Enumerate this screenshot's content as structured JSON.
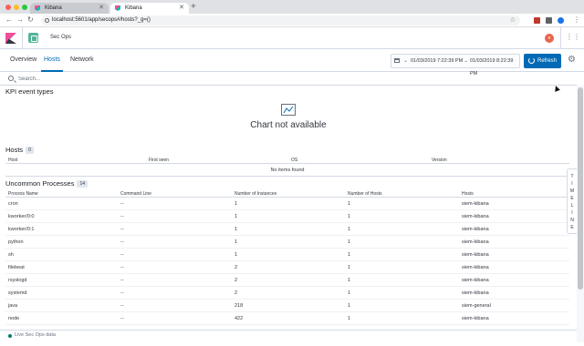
{
  "browser": {
    "tabs": [
      {
        "title": "Kibana",
        "active": false
      },
      {
        "title": "Kibana",
        "active": true
      }
    ],
    "url": "localhost:5601/app/secops#/hosts?_g=()"
  },
  "kibana": {
    "breadcrumb": "Sec Ops",
    "avatar_initial": "e"
  },
  "subnav": {
    "tabs": [
      "Overview",
      "Hosts",
      "Network"
    ],
    "active_tab": "Hosts",
    "date_start": "01/03/2019 7:22:39 PM",
    "date_arrow": "→",
    "date_end": "01/03/2019 8:22:39 PM",
    "refresh_label": "Refresh"
  },
  "search": {
    "placeholder": "Search..."
  },
  "kpi": {
    "title": "KPI event types",
    "message": "Chart not available"
  },
  "hosts": {
    "title": "Hosts",
    "count": "0",
    "columns": [
      "Host",
      "First seen",
      "OS",
      "Version"
    ],
    "empty_message": "No items found"
  },
  "uncommon": {
    "title": "Uncommon Processes",
    "count": "14",
    "columns": [
      "Process Name",
      "Command Line",
      "Number of Instances",
      "Number of Hosts",
      "Hosts"
    ],
    "rows": [
      [
        "cron",
        "--",
        "1",
        "1",
        "siem-kibana"
      ],
      [
        "kworker/0:0",
        "--",
        "1",
        "1",
        "siem-kibana"
      ],
      [
        "kworker/0:1",
        "--",
        "1",
        "1",
        "siem-kibana"
      ],
      [
        "python",
        "--",
        "1",
        "1",
        "siem-kibana"
      ],
      [
        "sh",
        "--",
        "1",
        "1",
        "siem-kibana"
      ],
      [
        "filebeat",
        "--",
        "2",
        "1",
        "siem-kibana"
      ],
      [
        "rsyslogd",
        "--",
        "2",
        "1",
        "siem-kibana"
      ],
      [
        "systemd",
        "--",
        "2",
        "1",
        "siem-kibana"
      ],
      [
        "java",
        "--",
        "218",
        "1",
        "siem-general"
      ],
      [
        "node",
        "--",
        "422",
        "1",
        "siem-kibana"
      ]
    ]
  },
  "timeline": {
    "letters": [
      "T",
      "I",
      "M",
      "E",
      "L",
      "I",
      "N",
      "E"
    ]
  },
  "footer": {
    "text": "Live Sec Ops data"
  }
}
